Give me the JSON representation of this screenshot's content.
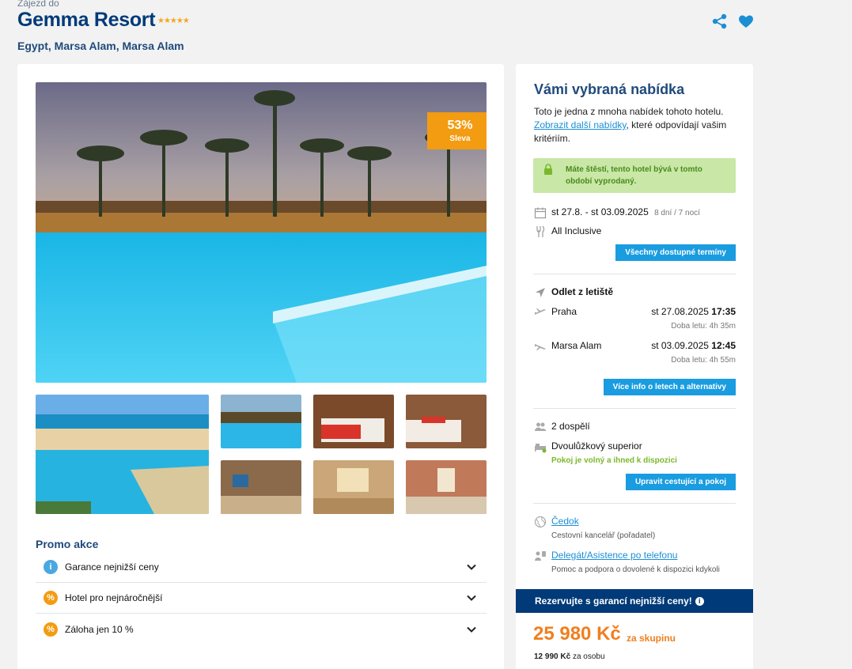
{
  "header": {
    "kicker": "Zájezd do",
    "title": "Gemma Resort",
    "stars": "★★★★★",
    "location": "Egypt, Marsa Alam, Marsa Alam"
  },
  "gallery": {
    "discount_pct": "53%",
    "discount_label": "Sleva"
  },
  "promo": {
    "title": "Promo akce",
    "items": [
      {
        "label": "Garance nejnižší ceny",
        "icon": "info-icon",
        "color": "#4aa8e0"
      },
      {
        "label": "Hotel pro nejnáročnější",
        "icon": "percent-icon",
        "color": "#f39c12"
      },
      {
        "label": "Záloha jen 10 %",
        "icon": "percent-icon",
        "color": "#f39c12"
      }
    ]
  },
  "offer": {
    "title": "Vámi vybraná nabídka",
    "desc_before": "Toto je jedna z mnoha nabídek tohoto hotelu.",
    "desc_link": "Zobrazit další nabídky",
    "desc_after": ", které odpovídají vašim kritériím.",
    "notice": "Máte štěstí, tento hotel bývá v tomto období vyprodaný.",
    "dates": "st 27.8. - st 03.09.2025",
    "duration": "8 dní / 7 nocí",
    "board": "All Inclusive",
    "btn_dates": "Všechny dostupné termíny",
    "departure_heading": "Odlet z letiště",
    "outbound": {
      "place": "Praha",
      "date": "st 27.08.2025",
      "time": "17:35",
      "duration": "Doba letu: 4h 35m"
    },
    "inbound": {
      "place": "Marsa Alam",
      "date": "st 03.09.2025",
      "time": "12:45",
      "duration": "Doba letu: 4h 55m"
    },
    "btn_flights": "Více info o letech a alternativy",
    "travellers": "2 dospělí",
    "room": "Dvoulůžkový superior",
    "room_status": "Pokoj je volný a ihned k dispozici",
    "btn_edit": "Upravit cestující a pokoj",
    "agency_name": "Čedok",
    "agency_sub": "Cestovní kancelář (pořadatel)",
    "support_name": "Delegát/Asistence po telefonu",
    "support_sub": "Pomoc a podpora o dovolené k dispozici kdykoli",
    "guarantee": "Rezervujte s garancí nejnižší ceny!",
    "price": "25 980 Kč",
    "price_suffix": "za skupinu",
    "per_person_value": "12 990 Kč",
    "per_person_suffix": "za osobu"
  },
  "colors": {
    "brand_blue": "#003a78",
    "accent_blue": "#1a9ce0",
    "orange": "#f39c12",
    "price_orange": "#f07f1e",
    "notice_bg": "#c9e7a7",
    "green": "#7ab82b"
  }
}
